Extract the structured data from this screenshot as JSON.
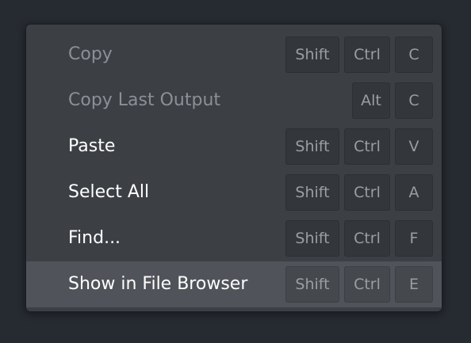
{
  "menu": {
    "items": [
      {
        "label": "Copy",
        "enabled": false,
        "shortcut": [
          "Shift",
          "Ctrl",
          "C"
        ]
      },
      {
        "label": "Copy Last Output",
        "enabled": false,
        "shortcut": [
          "Alt",
          "C"
        ]
      },
      {
        "label": "Paste",
        "enabled": true,
        "shortcut": [
          "Shift",
          "Ctrl",
          "V"
        ]
      },
      {
        "label": "Select All",
        "enabled": true,
        "shortcut": [
          "Shift",
          "Ctrl",
          "A"
        ]
      },
      {
        "label": "Find...",
        "enabled": true,
        "shortcut": [
          "Shift",
          "Ctrl",
          "F"
        ]
      },
      {
        "label": "Show in File Browser",
        "enabled": true,
        "highlighted": true,
        "shortcut": [
          "Shift",
          "Ctrl",
          "E"
        ]
      }
    ]
  },
  "colors": {
    "menu_background": "#3c3f44",
    "highlight": "#50545a",
    "text": "#ffffff",
    "text_disabled": "#8c9096",
    "keycap": "#33363a"
  }
}
